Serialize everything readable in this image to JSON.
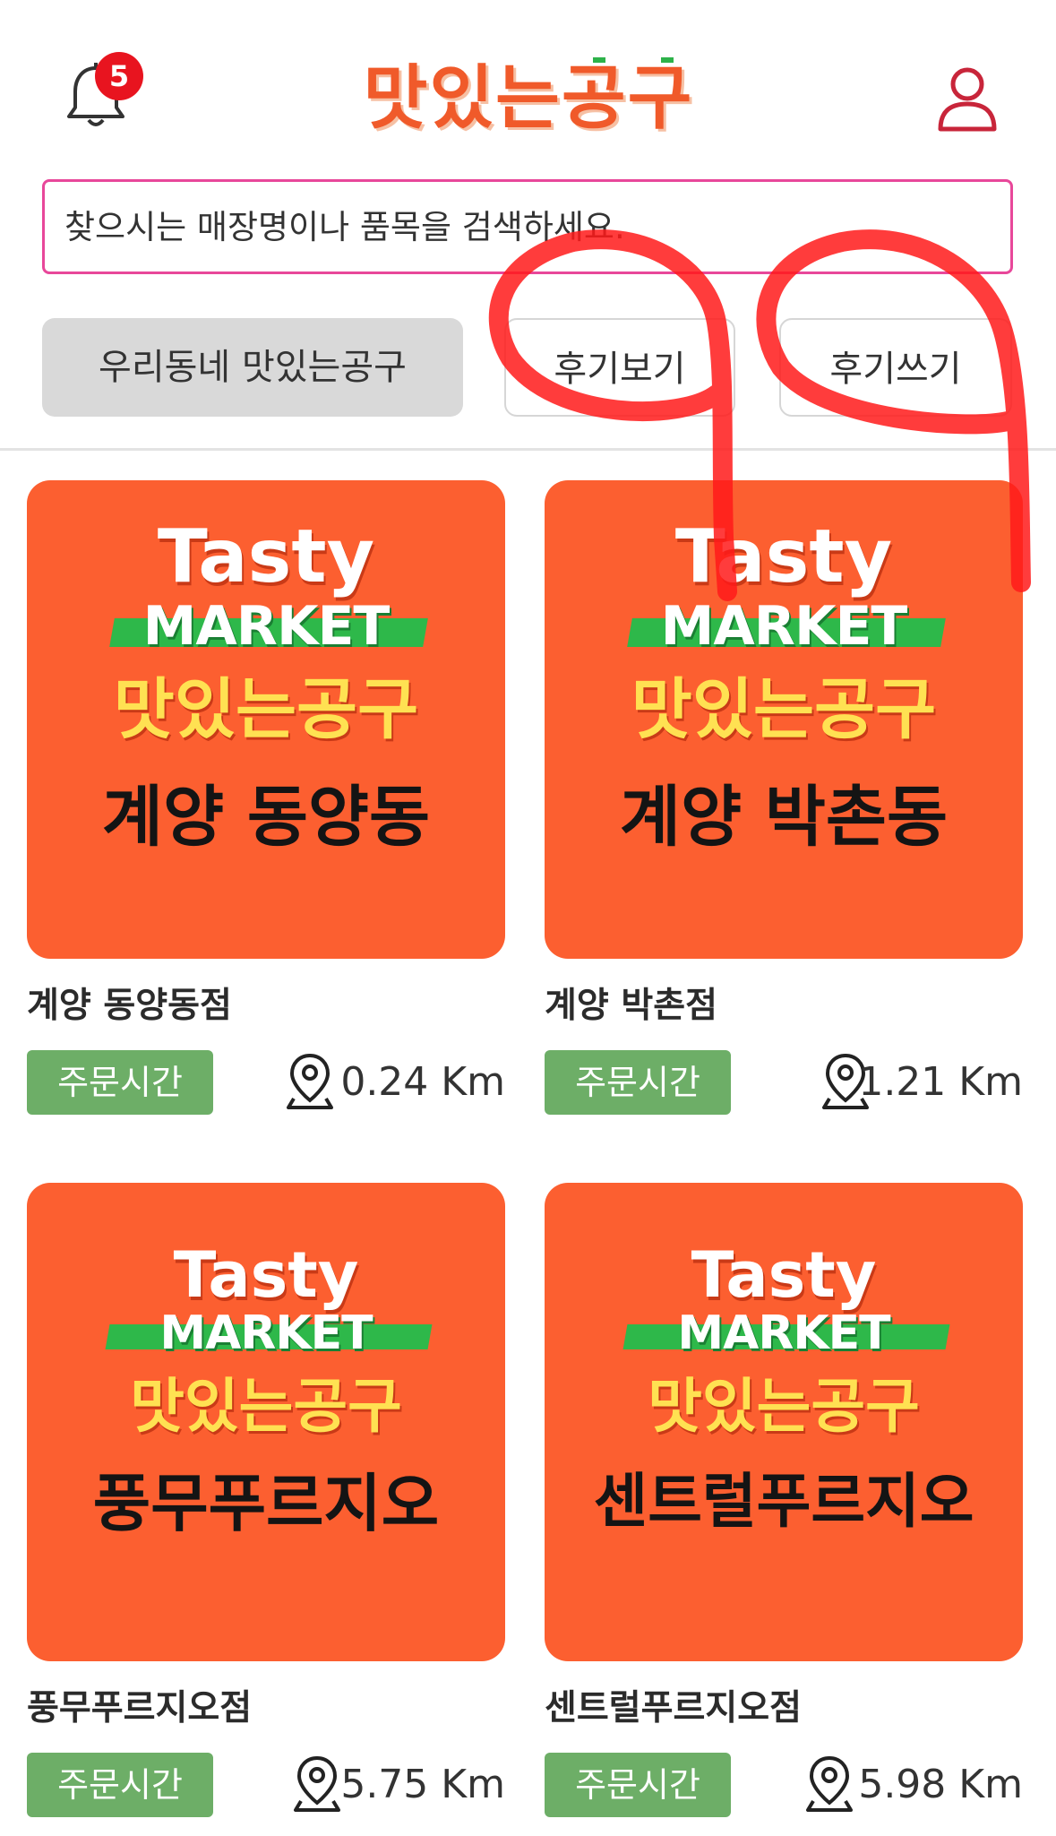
{
  "header": {
    "notification_count": "5",
    "logo_text": "맛있는공구",
    "bell_icon": "bell-icon",
    "user_icon": "user-icon"
  },
  "search": {
    "placeholder": "찾으시는 매장명이나 품목을 검색하세요.",
    "value": ""
  },
  "filters": {
    "local_label": "우리동네 맛있는공구",
    "review_view_label": "후기보기",
    "review_write_label": "후기쓰기"
  },
  "stores": [
    {
      "banner_tasty": "Tasty",
      "banner_market": "MARKET",
      "banner_brand": "맛있는공구",
      "banner_name": "계양 동양동",
      "title": "계양 동양동점",
      "order_label": "주문시간",
      "distance": "0.24 Km"
    },
    {
      "banner_tasty": "Tasty",
      "banner_market": "MARKET",
      "banner_brand": "맛있는공구",
      "banner_name": "계양 박촌동",
      "title": "계양 박촌점",
      "order_label": "주문시간",
      "distance": "1.21 Km"
    },
    {
      "banner_tasty": "Tasty",
      "banner_market": "MARKET",
      "banner_brand": "맛있는공구",
      "banner_name": "풍무푸르지오",
      "title": "풍무푸르지오점",
      "order_label": "주문시간",
      "distance": "5.75 Km"
    },
    {
      "banner_tasty": "Tasty",
      "banner_market": "MARKET",
      "banner_brand": "맛있는공구",
      "banner_name": "센트럴푸르지오",
      "title": "센트럴푸르지오점",
      "order_label": "주문시간",
      "distance": "5.98 Km"
    }
  ],
  "colors": {
    "brand_orange": "#fc5f30",
    "logo_orange": "#f05a2a",
    "badge_red": "#e8141f",
    "search_border": "#e8479a",
    "order_green": "#6dae67",
    "market_green": "#2eb84a",
    "brand_yellow": "#ffe152",
    "annotation_red": "#ff1a1a"
  },
  "icons": {
    "location": "location-pin-icon"
  }
}
